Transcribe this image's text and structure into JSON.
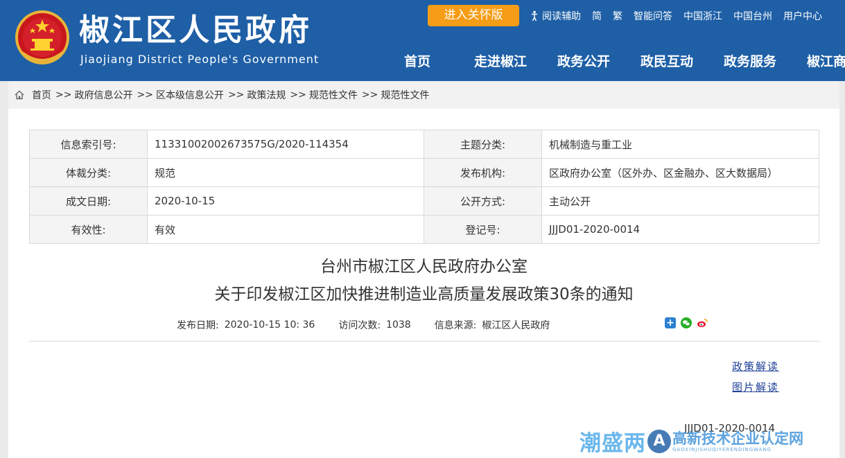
{
  "header": {
    "site_title": "椒江区人民政府",
    "site_subtitle": "Jiaojiang District People's Government",
    "care_button": "进入关怀版",
    "top_links": [
      "阅读辅助",
      "简",
      "繁",
      "智能问答",
      "中国浙江",
      "中国台州",
      "用户中心"
    ],
    "nav": [
      "首页",
      "走进椒江",
      "政务公开",
      "政民互动",
      "政务服务",
      "椒江商务"
    ]
  },
  "breadcrumb": {
    "items": [
      "首页",
      "政府信息公开",
      "区本级信息公开",
      "政策法规",
      "规范性文件",
      "规范性文件"
    ],
    "separator": ">>"
  },
  "info_table": {
    "rows": [
      {
        "l1": "信息索引号:",
        "v1": "11331002002673575G/2020-114354",
        "l2": "主题分类:",
        "v2": "机械制造与重工业"
      },
      {
        "l1": "体裁分类:",
        "v1": "规范",
        "l2": "发布机构:",
        "v2": "区政府办公室（区外办、区金融办、区大数据局）"
      },
      {
        "l1": "成文日期:",
        "v1": "2020-10-15",
        "l2": "公开方式:",
        "v2": "主动公开"
      },
      {
        "l1": "有效性:",
        "v1": "有效",
        "l2": "登记号:",
        "v2": "JJJD01-2020-0014"
      }
    ]
  },
  "document": {
    "title_line1": "台州市椒江区人民政府办公室",
    "title_line2": "关于印发椒江区加快推进制造业高质量发展政策30条的通知",
    "publish_label": "发布日期:",
    "publish_value": "2020-10-15 10: 36",
    "visits_label": "访问次数:",
    "visits_value": "1038",
    "source_label": "信息来源:",
    "source_value": "椒江区人民政府",
    "links": [
      "政策解读",
      "图片解读"
    ],
    "doc_number": "JJJD01-2020-0014"
  },
  "watermark": {
    "left": "潮盛两",
    "badge": "A",
    "right": "高新技术企业认定网",
    "small": "GAOXINJISHUQIYERENDINGWANG"
  },
  "colors": {
    "header_bg": "#1e5fa6",
    "care_button_bg": "#f59d16",
    "link": "#1e3f9a"
  }
}
